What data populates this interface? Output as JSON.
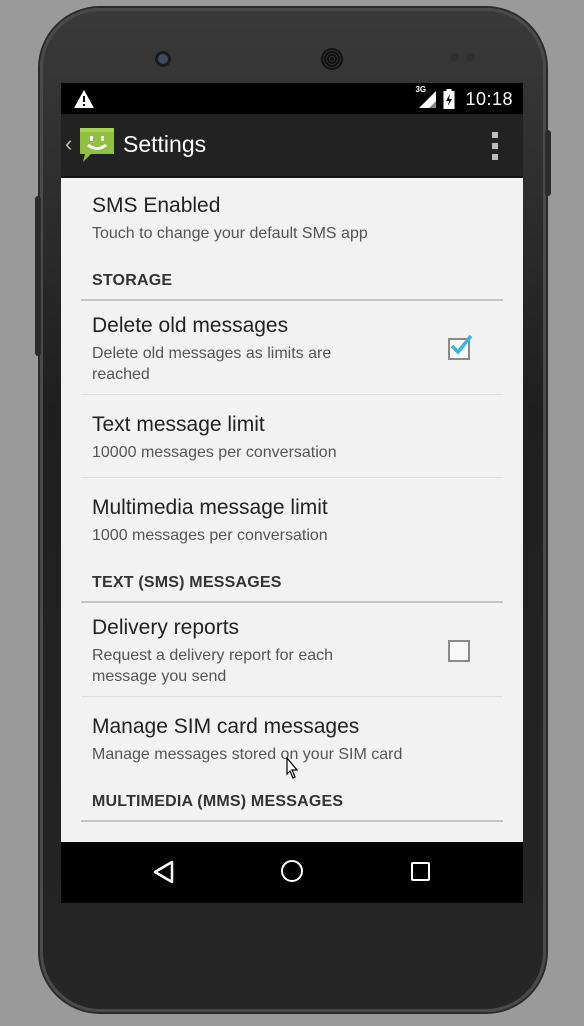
{
  "statusbar": {
    "network": "3G",
    "time": "10:18"
  },
  "actionbar": {
    "title": "Settings"
  },
  "settings": {
    "sms_enabled": {
      "title": "SMS Enabled",
      "summary": "Touch to change your default SMS app"
    },
    "storage_header": "STORAGE",
    "delete_old": {
      "title": "Delete old messages",
      "summary_line1": "Delete old messages as limits are",
      "summary_line2": "reached",
      "checked": true
    },
    "text_limit": {
      "title": "Text message limit",
      "summary": "10000 messages per conversation"
    },
    "mms_limit": {
      "title": "Multimedia message limit",
      "summary": "1000 messages per conversation"
    },
    "sms_header": "TEXT (SMS) MESSAGES",
    "delivery": {
      "title": "Delivery reports",
      "summary_line1": "Request a delivery report for each",
      "summary_line2": "message you send",
      "checked": false
    },
    "sim": {
      "title": "Manage SIM card messages",
      "summary": "Manage messages stored on your SIM card"
    },
    "mms_header": "MULTIMEDIA (MMS) MESSAGES"
  },
  "colors": {
    "accent": "#33b5e5",
    "actionbar": "#222222",
    "background": "#f2f2f2"
  },
  "icons": [
    "warning-icon",
    "signal-icon",
    "battery-icon",
    "messaging-app-icon",
    "overflow-menu-icon",
    "back-nav-icon",
    "home-nav-icon",
    "recents-nav-icon"
  ]
}
